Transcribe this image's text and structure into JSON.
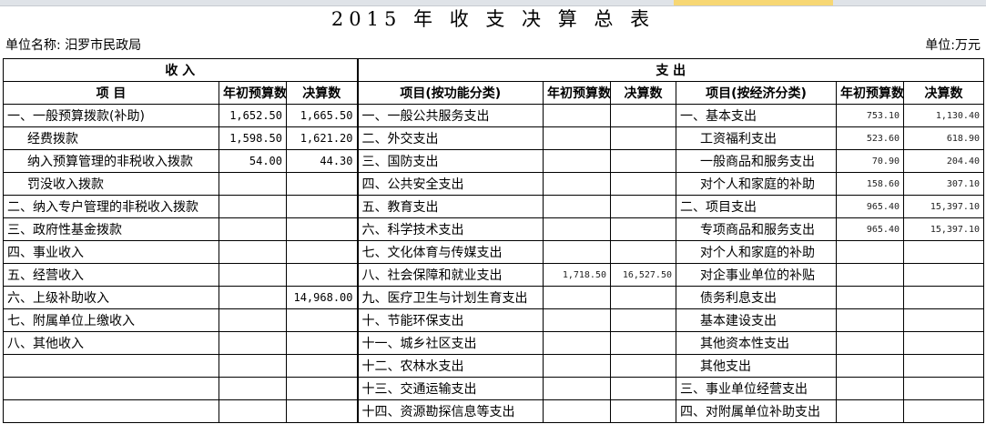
{
  "title": "2015 年 收 支 决 算 总 表",
  "unit_name": "单位名称: 汨罗市民政局",
  "unit": "单位:万元",
  "header": {
    "income": "收          入",
    "expense": "支                    出",
    "item": "项          目",
    "budget": "年初预算数",
    "actual": "决算数",
    "item_func": "项目(按功能分类)",
    "item_econ": "项目(按经济分类)"
  },
  "rows": [
    {
      "inc": "一、一般预算拨款(补助)",
      "inc_b": "1,652.50",
      "inc_a": "1,665.50",
      "fun": "一、一般公共服务支出",
      "fun_b": "",
      "fun_a": "",
      "eco": "一、基本支出",
      "eco_b": "753.10",
      "eco_a": "1,130.40"
    },
    {
      "inc": "经费拨款",
      "inc_b": "1,598.50",
      "inc_a": "1,621.20",
      "fun": "二、外交支出",
      "fun_b": "",
      "fun_a": "",
      "eco": "工资福利支出",
      "eco_b": "523.60",
      "eco_a": "618.90"
    },
    {
      "inc": "纳入预算管理的非税收入拨款",
      "inc_b": "54.00",
      "inc_a": "44.30",
      "fun": "三、国防支出",
      "fun_b": "",
      "fun_a": "",
      "eco": "一般商品和服务支出",
      "eco_b": "70.90",
      "eco_a": "204.40"
    },
    {
      "inc": "罚没收入拨款",
      "inc_b": "",
      "inc_a": "",
      "fun": "四、公共安全支出",
      "fun_b": "",
      "fun_a": "",
      "eco": "对个人和家庭的补助",
      "eco_b": "158.60",
      "eco_a": "307.10"
    },
    {
      "inc": "二、纳入专户管理的非税收入拨款",
      "inc_b": "",
      "inc_a": "",
      "fun": "五、教育支出",
      "fun_b": "",
      "fun_a": "",
      "eco": "二、项目支出",
      "eco_b": "965.40",
      "eco_a": "15,397.10"
    },
    {
      "inc": "三、政府性基金拨款",
      "inc_b": "",
      "inc_a": "",
      "fun": "六、科学技术支出",
      "fun_b": "",
      "fun_a": "",
      "eco": "专项商品和服务支出",
      "eco_b": "965.40",
      "eco_a": "15,397.10"
    },
    {
      "inc": "四、事业收入",
      "inc_b": "",
      "inc_a": "",
      "fun": "七、文化体育与传媒支出",
      "fun_b": "",
      "fun_a": "",
      "eco": "对个人和家庭的补助",
      "eco_b": "",
      "eco_a": ""
    },
    {
      "inc": "五、经营收入",
      "inc_b": "",
      "inc_a": "",
      "fun": "八、社会保障和就业支出",
      "fun_b": "1,718.50",
      "fun_a": "16,527.50",
      "eco": "对企事业单位的补贴",
      "eco_b": "",
      "eco_a": ""
    },
    {
      "inc": "六、上级补助收入",
      "inc_b": "",
      "inc_a": "14,968.00",
      "fun": "九、医疗卫生与计划生育支出",
      "fun_b": "",
      "fun_a": "",
      "eco": "债务利息支出",
      "eco_b": "",
      "eco_a": ""
    },
    {
      "inc": "七、附属单位上缴收入",
      "inc_b": "",
      "inc_a": "",
      "fun": "十、节能环保支出",
      "fun_b": "",
      "fun_a": "",
      "eco": "基本建设支出",
      "eco_b": "",
      "eco_a": ""
    },
    {
      "inc": "八、其他收入",
      "inc_b": "",
      "inc_a": "",
      "fun": "十一、城乡社区支出",
      "fun_b": "",
      "fun_a": "",
      "eco": "其他资本性支出",
      "eco_b": "",
      "eco_a": ""
    },
    {
      "inc": "",
      "inc_b": "",
      "inc_a": "",
      "fun": "十二、农林水支出",
      "fun_b": "",
      "fun_a": "",
      "eco": "其他支出",
      "eco_b": "",
      "eco_a": ""
    },
    {
      "inc": "",
      "inc_b": "",
      "inc_a": "",
      "fun": "十三、交通运输支出",
      "fun_b": "",
      "fun_a": "",
      "eco": "三、事业单位经营支出",
      "eco_b": "",
      "eco_a": ""
    },
    {
      "inc": "",
      "inc_b": "",
      "inc_a": "",
      "fun": "十四、资源勘探信息等支出",
      "fun_b": "",
      "fun_a": "",
      "eco": "四、对附属单位补助支出",
      "eco_b": "",
      "eco_a": ""
    }
  ]
}
